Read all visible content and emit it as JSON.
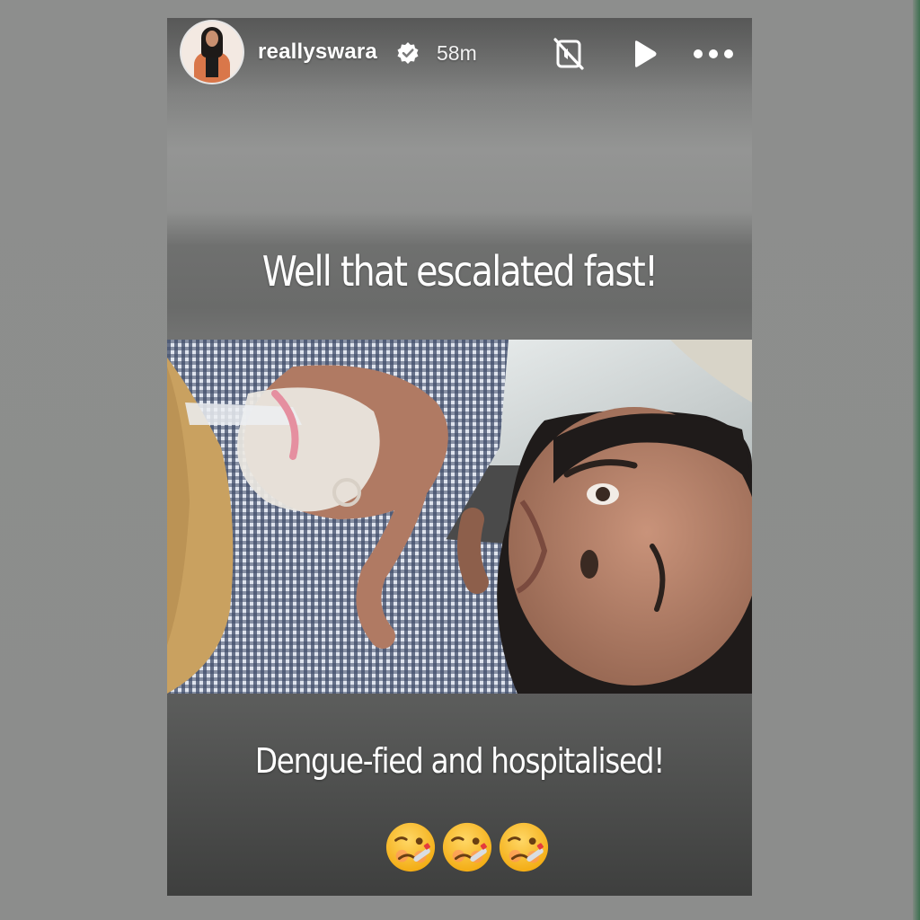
{
  "story": {
    "username": "reallyswara",
    "timestamp": "58m",
    "headline": "Well that escalated fast!",
    "caption": "Dengue-fied and hospitalised!",
    "emojis": [
      "woozy-face",
      "woozy-face",
      "woozy-face"
    ]
  },
  "icons": {
    "verified": "verified-badge-icon",
    "mute": "sound-off-icon",
    "play": "play-icon",
    "more": "more-options-icon"
  },
  "colors": {
    "text": "#ffffff",
    "background": "#8e8f8e"
  }
}
